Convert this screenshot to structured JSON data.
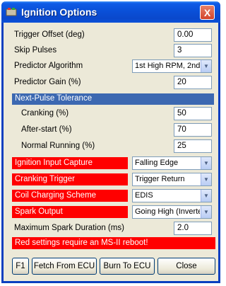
{
  "window": {
    "title": "Ignition Options",
    "close_glyph": "X"
  },
  "fields": {
    "trigger_offset": {
      "label": "Trigger Offset (deg)",
      "value": "0.00"
    },
    "skip_pulses": {
      "label": "Skip Pulses",
      "value": "3"
    },
    "predictor_algorithm": {
      "label": "Predictor Algorithm",
      "value": "1st High RPM, 2nd"
    },
    "predictor_gain": {
      "label": "Predictor Gain (%)",
      "value": "20"
    }
  },
  "tolerance": {
    "header": "Next-Pulse Tolerance",
    "cranking": {
      "label": "Cranking (%)",
      "value": "50"
    },
    "after_start": {
      "label": "After-start (%)",
      "value": "70"
    },
    "normal_running": {
      "label": "Normal Running (%)",
      "value": "25"
    }
  },
  "red_settings": {
    "ignition_input_capture": {
      "label": "Ignition Input Capture",
      "value": "Falling Edge"
    },
    "cranking_trigger": {
      "label": "Cranking Trigger",
      "value": "Trigger Return"
    },
    "coil_charging_scheme": {
      "label": "Coil Charging Scheme",
      "value": "EDIS"
    },
    "spark_output": {
      "label": "Spark Output",
      "value": "Going High (Inverte"
    }
  },
  "max_spark": {
    "label": "Maximum Spark Duration (ms)",
    "value": "2.0"
  },
  "warning": "Red settings require an MS-II reboot!",
  "buttons": {
    "f1": "F1",
    "fetch": "Fetch From ECU",
    "burn": "Burn To ECU",
    "close": "Close"
  },
  "colors": {
    "title_bar": "#0a50d8",
    "section_header": "#3c68b1",
    "reboot_required": "#ff0000",
    "dialog_bg": "#ece9d8"
  }
}
